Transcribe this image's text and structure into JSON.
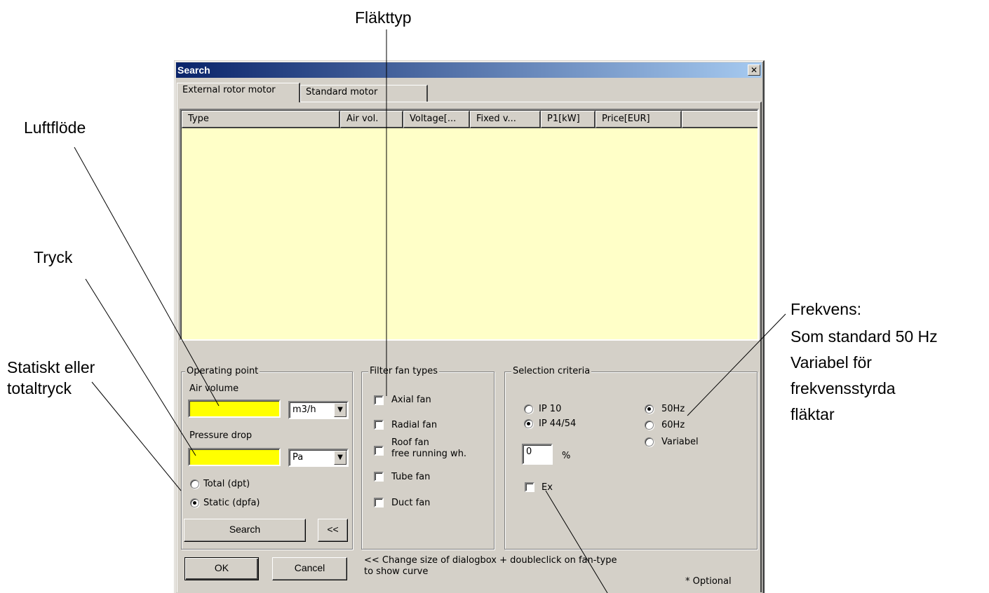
{
  "annotations": {
    "fan_type": "Fläkttyp",
    "air_flow": "Luftflöde",
    "pressure": "Tryck",
    "static_or_total_line1": "Statiskt eller",
    "static_or_total_line2": "totaltryck",
    "frequency_line1": "Frekvens:",
    "frequency_line2": "Som standard 50 Hz",
    "frequency_line3": "Variabel för",
    "frequency_line4": "frekvensstyrda",
    "frequency_line5": "fläktar"
  },
  "dialog": {
    "title": "Search",
    "close_glyph": "✕"
  },
  "tabs": [
    {
      "label": "External rotor motor",
      "active": true
    },
    {
      "label": "Standard motor",
      "active": false
    }
  ],
  "table": {
    "columns": [
      "Type",
      "Air vol.",
      "Voltage[...",
      "Fixed v...",
      "P1[kW]",
      "Price[EUR]",
      ""
    ],
    "background": "#ffffc8",
    "rows": []
  },
  "operating_point": {
    "legend": "Operating point",
    "air_volume_label": "Air volume",
    "air_volume_value": "",
    "air_volume_unit": "m3/h",
    "pressure_drop_label": "Pressure drop",
    "pressure_drop_value": "",
    "pressure_drop_unit": "Pa",
    "total_label": "Total (dpt)",
    "static_label": "Static (dpfa)",
    "selected_pressure_type": "Static (dpfa)",
    "search_button": "Search",
    "collapse_button": "<<",
    "input_color": "#ffff00"
  },
  "filter_fan_types": {
    "legend": "Filter fan types",
    "axial": "Axial fan",
    "radial": "Radial fan",
    "roof_line1": "Roof fan",
    "roof_line2": "free running wh.",
    "tube": "Tube fan",
    "duct": "Duct fan"
  },
  "selection_criteria": {
    "legend": "Selection criteria",
    "ip10": "IP 10",
    "ip44": "IP 44/54",
    "selected_ip": "IP 44/54",
    "hz50": "50Hz",
    "hz60": "60Hz",
    "variabel": "Variabel",
    "selected_frequency": "50Hz",
    "percent_value": "0",
    "percent_sign": "%",
    "ex_label": "Ex"
  },
  "footer": {
    "ok_button": "OK",
    "cancel_button": "Cancel",
    "hint_line1": "<< Change size of dialogbox + doubleclick on fan-type",
    "hint_line2": "to show curve",
    "optional_note": "* Optional"
  },
  "colors": {
    "dialog_face": "#d4d0c8",
    "titlebar_start": "#0a246a",
    "titlebar_end": "#a6caf0"
  }
}
